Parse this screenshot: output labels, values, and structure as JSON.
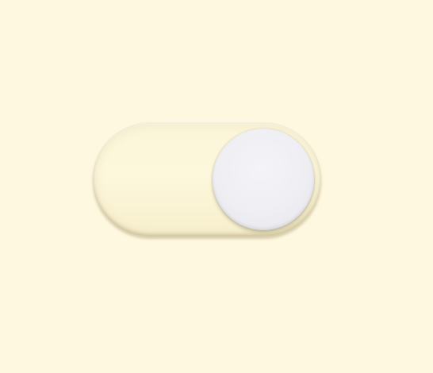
{
  "toggle": {
    "state": "on",
    "track_color": "#fdf7dc",
    "knob_color": "#eeeef3",
    "background_color": "#fff8e0"
  }
}
